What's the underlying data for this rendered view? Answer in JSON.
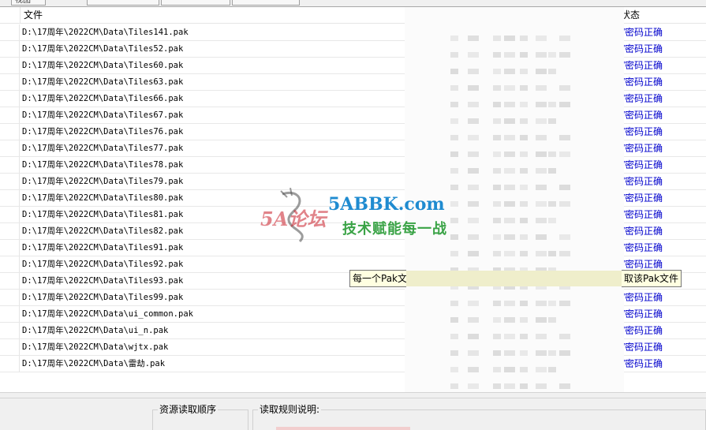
{
  "tabs": [
    "视图",
    "",
    "",
    "",
    ""
  ],
  "columns": {
    "file": "文件",
    "status": "状态"
  },
  "rows": [
    {
      "path": "D:\\17周年\\2022CM\\Data\\Tiles141.pak",
      "status": "/密码正确"
    },
    {
      "path": "D:\\17周年\\2022CM\\Data\\Tiles52.pak",
      "status": "/密码正确"
    },
    {
      "path": "D:\\17周年\\2022CM\\Data\\Tiles60.pak",
      "status": "/密码正确"
    },
    {
      "path": "D:\\17周年\\2022CM\\Data\\Tiles63.pak",
      "status": "/密码正确"
    },
    {
      "path": "D:\\17周年\\2022CM\\Data\\Tiles66.pak",
      "status": "/密码正确"
    },
    {
      "path": "D:\\17周年\\2022CM\\Data\\Tiles67.pak",
      "status": "/密码正确"
    },
    {
      "path": "D:\\17周年\\2022CM\\Data\\Tiles76.pak",
      "status": "/密码正确"
    },
    {
      "path": "D:\\17周年\\2022CM\\Data\\Tiles77.pak",
      "status": "/密码正确"
    },
    {
      "path": "D:\\17周年\\2022CM\\Data\\Tiles78.pak",
      "status": "/密码正确"
    },
    {
      "path": "D:\\17周年\\2022CM\\Data\\Tiles79.pak",
      "status": "/密码正确"
    },
    {
      "path": "D:\\17周年\\2022CM\\Data\\Tiles80.pak",
      "status": "/密码正确"
    },
    {
      "path": "D:\\17周年\\2022CM\\Data\\Tiles81.pak",
      "status": "/密码正确"
    },
    {
      "path": "D:\\17周年\\2022CM\\Data\\Tiles82.pak",
      "status": "/密码正确"
    },
    {
      "path": "D:\\17周年\\2022CM\\Data\\Tiles91.pak",
      "status": "/密码正确"
    },
    {
      "path": "D:\\17周年\\2022CM\\Data\\Tiles92.pak",
      "status": "/密码正确"
    },
    {
      "path": "D:\\17周年\\2022CM\\Data\\Tiles93.pak",
      "status": ""
    },
    {
      "path": "D:\\17周年\\2022CM\\Data\\Tiles99.pak",
      "status": "/密码正确"
    },
    {
      "path": "D:\\17周年\\2022CM\\Data\\ui_common.pak",
      "status": "/密码正确"
    },
    {
      "path": "D:\\17周年\\2022CM\\Data\\ui_n.pak",
      "status": "/密码正确"
    },
    {
      "path": "D:\\17周年\\2022CM\\Data\\wjtx.pak",
      "status": "/密码正确"
    },
    {
      "path": "D:\\17周年\\2022CM\\Data\\雷劫.pak",
      "status": "/密码正确"
    }
  ],
  "tooltip": {
    "left_text": "每一个Pak文",
    "right_text": "取该Pak文件"
  },
  "watermark": {
    "logo_text": "5A论坛",
    "site": "5ABBK.com",
    "slogan": "技术赋能每一战"
  },
  "bottom": {
    "order_title": "资源读取顺序",
    "rules_title": "读取规则说明:"
  },
  "colors": {
    "status_blue": "#0000cc",
    "tooltip_bg": "#ffffe1",
    "watermark_red": "#c81e28",
    "watermark_blue": "#1f8bd0",
    "watermark_green": "#3aa346"
  }
}
